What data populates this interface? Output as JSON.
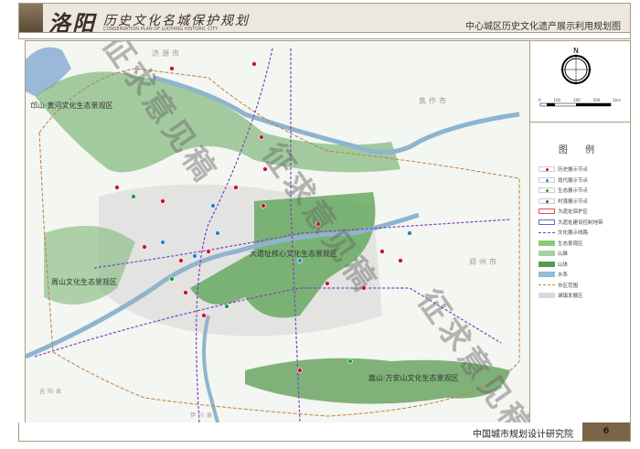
{
  "header": {
    "logo_main": "洛阳",
    "logo_sub": "历史文化名城保护规划",
    "logo_en": "CONSERVATION PLAN OF LUOYANG HISTORIC CITY",
    "sheet_title": "中心城区历史文化遗产展示利用规划图"
  },
  "map": {
    "zones": [
      "邙山·黄河文化生态景观区",
      "大遗址核心文化生态景观区",
      "周山文化生态景观区",
      "嵩山·万安山文化生态景观区"
    ],
    "cities": [
      "济源市",
      "焦作市",
      "郑州市",
      "伊川县",
      "宜阳县"
    ],
    "watermark": "征求意见稿"
  },
  "compass": {
    "north": "N",
    "scale_ticks": [
      "0",
      "100",
      "200",
      "500",
      "1km"
    ]
  },
  "legend": {
    "title": "图 例",
    "items": [
      {
        "label": "历史展示节点",
        "type": "dot",
        "color": "#d0103a"
      },
      {
        "label": "现代展示节点",
        "type": "dot",
        "color": "#1a8ad0"
      },
      {
        "label": "生态展示节点",
        "type": "dot",
        "color": "#1aa040"
      },
      {
        "label": "村落展示节点",
        "type": "dot",
        "color": "#555555"
      },
      {
        "label": "大遗址保护区",
        "type": "box",
        "color": "#e05050"
      },
      {
        "label": "大遗址建设控制地带",
        "type": "box",
        "color": "#6060d0"
      },
      {
        "label": "文化展示线路",
        "type": "dash",
        "color": "#8040c0"
      },
      {
        "label": "生态景观区",
        "type": "fill",
        "color": "#8cc87a"
      },
      {
        "label": "山脉",
        "type": "fill",
        "color": "#a8cfa0"
      },
      {
        "label": "山体",
        "type": "fill",
        "color": "#5a9a50"
      },
      {
        "label": "水系",
        "type": "fill",
        "color": "#8fbcd8"
      },
      {
        "label": "市区范围",
        "type": "dash",
        "color": "#c08040"
      },
      {
        "label": "城镇发展区",
        "type": "fill",
        "color": "#d8d8d8"
      }
    ]
  },
  "footer": {
    "org": "中国城市规划设计研究院",
    "page": "6"
  }
}
